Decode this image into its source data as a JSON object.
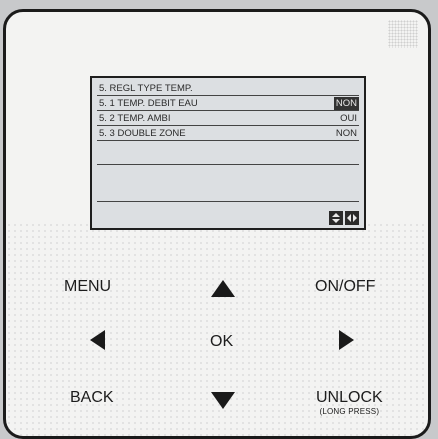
{
  "screen": {
    "title": "5. REGL TYPE TEMP.",
    "rows": [
      {
        "label": "5. 1 TEMP. DEBIT EAU",
        "value": "NON",
        "selected": true
      },
      {
        "label": "5. 2 TEMP. AMBI",
        "value": "OUI",
        "selected": false
      },
      {
        "label": "5. 3 DOUBLE ZONE",
        "value": "NON",
        "selected": false
      }
    ],
    "nav_icons": [
      "up-down-arrows-icon",
      "left-right-arrows-icon"
    ]
  },
  "keypad": {
    "menu": "MENU",
    "on_off": "ON/OFF",
    "ok": "OK",
    "back": "BACK",
    "unlock": "UNLOCK",
    "unlock_sub": "(LONG PRESS)",
    "up_icon": "up-triangle-icon",
    "down_icon": "down-triangle-icon",
    "left_icon": "left-triangle-icon",
    "right_icon": "right-triangle-icon"
  },
  "colors": {
    "body": "#f3f3f2",
    "screen": "#dcdfe2",
    "text": "#1d1d1d"
  }
}
